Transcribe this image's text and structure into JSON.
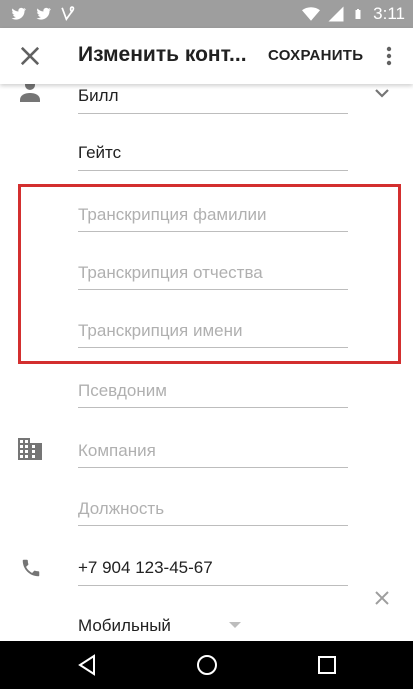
{
  "status_bar": {
    "time": "3:11",
    "left_icons": [
      "twitter-icon",
      "twitter-icon",
      "vine-icon"
    ],
    "right_icons": [
      "wifi-icon",
      "signal-icon",
      "battery-icon"
    ]
  },
  "app_bar": {
    "title": "Изменить конт...",
    "save_label": "СОХРАНИТЬ"
  },
  "form": {
    "first_name": "Билл",
    "last_name": "Гейтс",
    "phonetic_family_placeholder": "Транскрипция фамилии",
    "phonetic_middle_placeholder": "Транскрипция отчества",
    "phonetic_given_placeholder": "Транскрипция имени",
    "nickname_placeholder": "Псевдоним",
    "company_placeholder": "Компания",
    "job_title_placeholder": "Должность",
    "phone": "+7 904 123-45-67",
    "phone_type": "Мобильный"
  },
  "colors": {
    "status_bar": "#9e9e9e",
    "highlight": "#d32f2f",
    "nav_bar": "#000000"
  }
}
